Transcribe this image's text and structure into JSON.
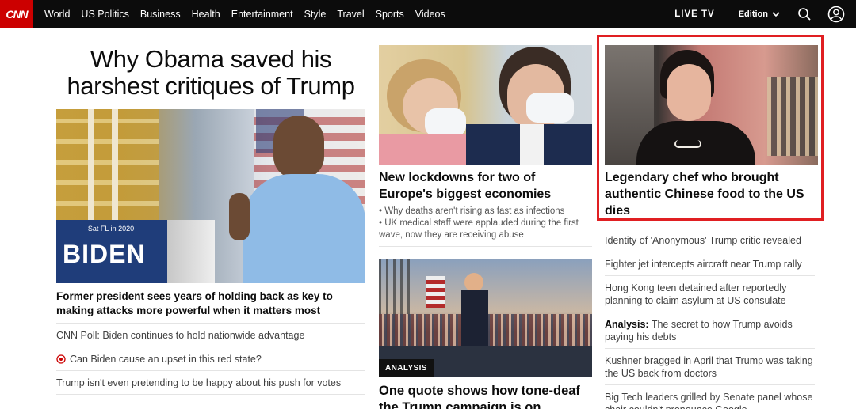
{
  "nav": {
    "logo": "CNN",
    "links": [
      "World",
      "US Politics",
      "Business",
      "Health",
      "Entertainment",
      "Style",
      "Travel",
      "Sports",
      "Videos"
    ],
    "live_tv": "LIVE TV",
    "edition": "Edition",
    "icons": [
      "chevron-down-icon",
      "search-icon",
      "user-icon"
    ]
  },
  "left": {
    "headline": "Why Obama saved his harshest critiques of Trump",
    "sign_small": "Sat FL in 2020",
    "sign_big": "BIDEN",
    "story": "Former president sees years of holding back as key to making attacks more powerful when it matters most",
    "items": [
      "CNN Poll: Biden continues to hold nationwide advantage",
      "Can Biden cause an upset in this red state?",
      "Trump isn't even pretending to be happy about his push for votes"
    ]
  },
  "mid": {
    "story1": "New lockdowns for two of Europe's biggest economies",
    "bullets": [
      "Why deaths aren't rising as fast as infections",
      "UK medical staff were applauded during the first wave, now they are receiving abuse"
    ],
    "badge": "ANALYSIS",
    "story2": "One quote shows how tone-deaf the Trump campaign is on"
  },
  "right": {
    "story": "Legendary chef who brought authentic Chinese food to the US dies",
    "items": [
      {
        "label": "",
        "text": "Identity of 'Anonymous' Trump critic revealed"
      },
      {
        "label": "",
        "text": "Fighter jet intercepts aircraft near Trump rally"
      },
      {
        "label": "",
        "text": "Hong Kong teen detained after reportedly planning to claim asylum at US consulate"
      },
      {
        "label": "Analysis:",
        "text": "The secret to how Trump avoids paying his debts"
      },
      {
        "label": "",
        "text": "Kushner bragged in April that Trump was taking the US back from doctors"
      },
      {
        "label": "",
        "text": "Big Tech leaders grilled by Senate panel whose chair couldn't pronounce Google"
      }
    ]
  },
  "colors": {
    "brand_red": "#cc0000",
    "highlight": "#e01f22",
    "nav_bg": "#0c0c0c"
  }
}
